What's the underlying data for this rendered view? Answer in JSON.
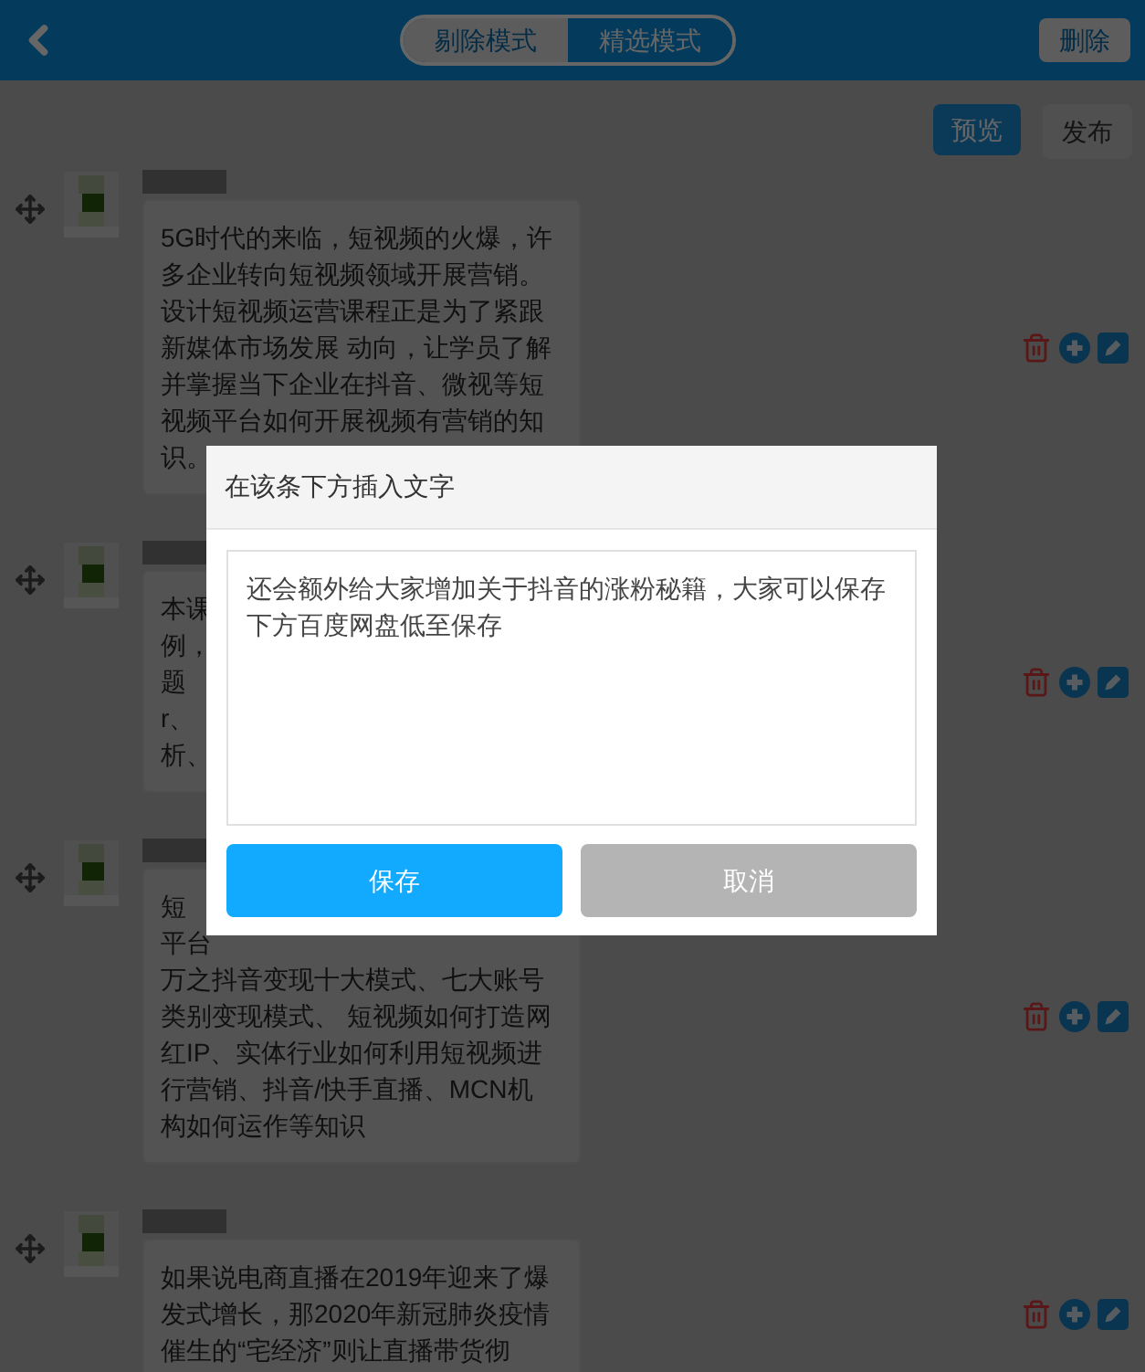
{
  "header": {
    "tabs": [
      {
        "label": "剔除模式",
        "selected": false
      },
      {
        "label": "精选模式",
        "selected": true
      }
    ],
    "delete_button": "删除"
  },
  "toolbar": {
    "buttons": [
      {
        "label": "预览",
        "kind": "primary"
      },
      {
        "label": "发布",
        "kind": "plain"
      }
    ]
  },
  "posts": [
    {
      "lines": [
        "5G时代的来临，短视频的火爆，许",
        "多企业转向短视频领域开展营销。",
        "设计短视频运营课程正是为了紧跟",
        "新媒体市场发展 动向，让学员了解",
        "并掌握当下企业在抖音、微视等短",
        "视频平台如何开展视频有营销的知",
        "识。"
      ]
    },
    {
      "lines": [
        "本课",
        "例，",
        "题",
        "r、",
        "析、"
      ]
    },
    {
      "lines": [
        "短",
        "平台",
        "万之抖音变现十大模式、七大账号",
        "类别变现模式、 短视频如何打造网",
        "红IP、实体行业如何利用短视频进",
        "行营销、抖音/快手直播、MCN机",
        "构如何运作等知识"
      ]
    },
    {
      "lines": [
        "如果说电商直播在2019年迎来了爆",
        "发式增长，那2020年新冠肺炎疫情",
        "催生的“宅经济”则让直播带货彻"
      ]
    }
  ],
  "dialog": {
    "title": "在该条下方插入文字",
    "value": "还会额外给大家增加关于抖音的涨粉秘籍，大家可以保存下方百度网盘低至保存",
    "buttons": [
      {
        "label": "保存",
        "kind": "primary"
      },
      {
        "label": "取消",
        "kind": "secondary"
      }
    ]
  }
}
